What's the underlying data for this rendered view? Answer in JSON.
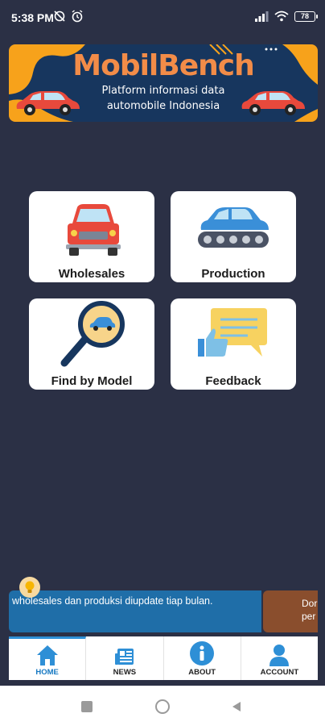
{
  "status_bar": {
    "time": "5:38 PM",
    "battery": "78"
  },
  "banner": {
    "title": "MobilBench",
    "subtitle_line1": "Platform informasi data",
    "subtitle_line2": "automobile Indonesia"
  },
  "menu": {
    "wholesales": "Wholesales",
    "production": "Production",
    "find_by_model": "Find by Model",
    "feedback": "Feedback"
  },
  "ticker": {
    "message": "wholesales dan produksi diupdate tiap bulan.",
    "next_line1": "Dor",
    "next_line2": "per"
  },
  "bottom_nav": {
    "home": "HOME",
    "news": "NEWS",
    "about": "ABOUT",
    "account": "ACCOUNT"
  },
  "colors": {
    "background": "#2b3045",
    "banner_bg": "#17365e",
    "accent_orange": "#f28c48",
    "active_tab": "#1578c2",
    "ticker_blue": "#1f6ea8"
  }
}
